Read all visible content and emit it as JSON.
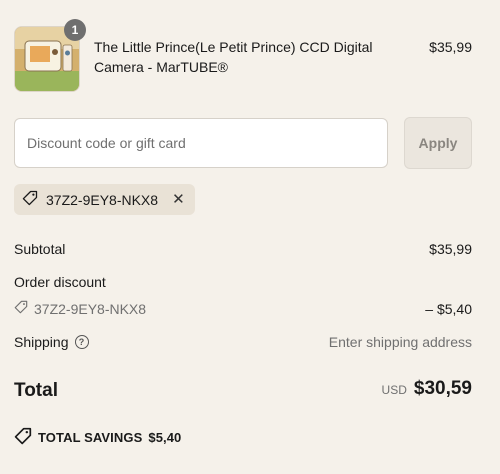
{
  "product": {
    "title": "The Little Prince(Le Petit Prince) CCD Digital Camera - MarTUBE®",
    "price": "$35,99",
    "quantity": "1",
    "image_icon": "product-thumbnail"
  },
  "discount": {
    "placeholder": "Discount code or gift card",
    "value": "",
    "apply_label": "Apply",
    "applied_code": "37Z2-9EY8-NKX8",
    "remove_icon": "close-icon"
  },
  "summary": {
    "subtotal_label": "Subtotal",
    "subtotal_value": "$35,99",
    "order_discount_label": "Order discount",
    "discount_code": "37Z2-9EY8-NKX8",
    "discount_value": "– $5,40",
    "shipping_label": "Shipping",
    "shipping_value": "Enter shipping address",
    "total_label": "Total",
    "currency": "USD",
    "total_value": "$30,59",
    "savings_label": "TOTAL SAVINGS",
    "savings_value": "$5,40"
  },
  "colors": {
    "background": "#f5f1ea",
    "chip": "#e9e2d6",
    "muted_text": "#707070",
    "apply_disabled": "#ebe6de"
  }
}
